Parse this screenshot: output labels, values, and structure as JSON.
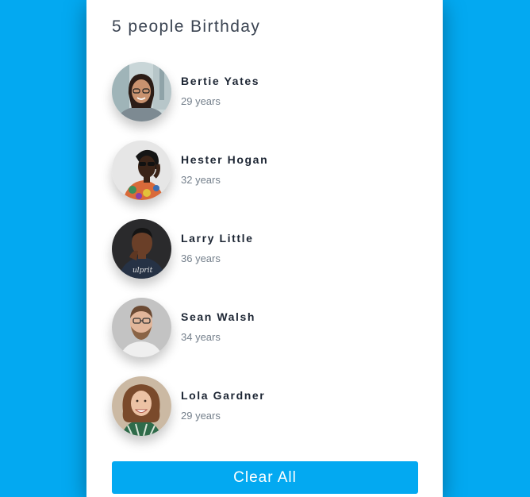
{
  "card": {
    "title": "5 people Birthday",
    "clear_label": "Clear All"
  },
  "people": [
    {
      "name": "Bertie Yates",
      "age": "29 years",
      "avatar": "woman-glasses-photo"
    },
    {
      "name": "Hester Hogan",
      "age": "32 years",
      "avatar": "woman-sunglasses-photo"
    },
    {
      "name": "Larry Little",
      "age": "36 years",
      "avatar": "man-dark-shirt-photo"
    },
    {
      "name": "Sean Walsh",
      "age": "34 years",
      "avatar": "man-glasses-beard-photo"
    },
    {
      "name": "Lola Gardner",
      "age": "29 years",
      "avatar": "woman-curly-hair-photo"
    }
  ],
  "colors": {
    "background": "#03a9f1",
    "button": "#03a9f1",
    "card": "#ffffff",
    "name_text": "#1c2533",
    "age_text": "#75808c"
  }
}
